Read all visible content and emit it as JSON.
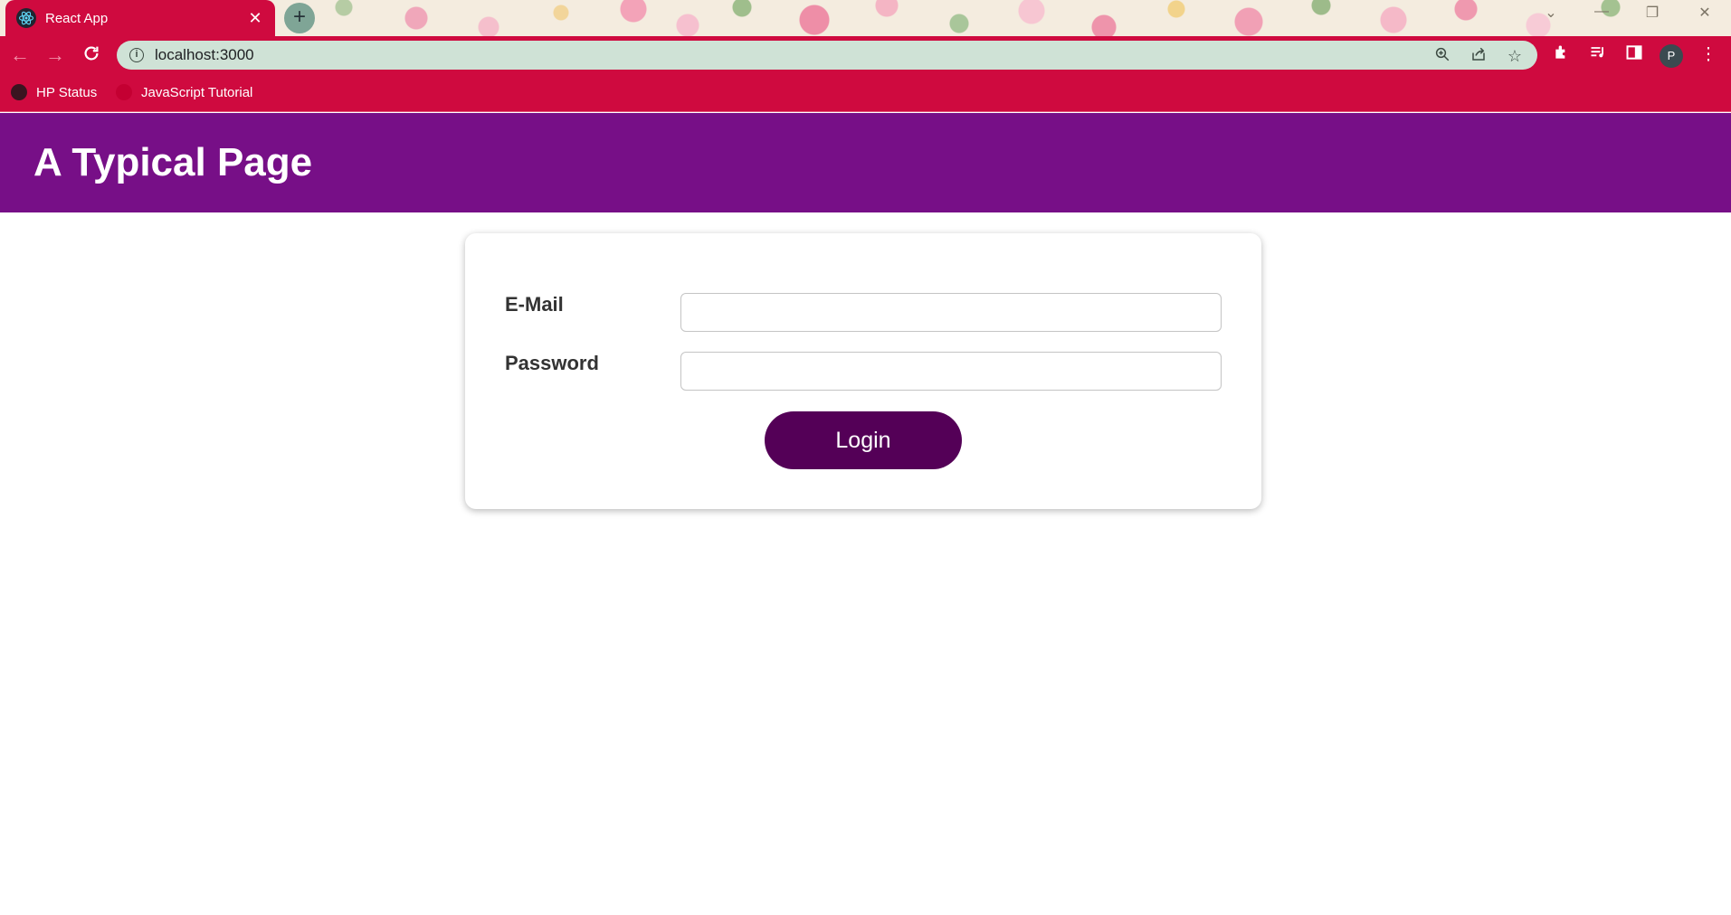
{
  "browser": {
    "tab_title": "React App",
    "tab_close": "✕",
    "new_tab": "+",
    "url": "localhost:3000",
    "profile_initial": "P",
    "icons": {
      "tab_favicon": "react-logo-icon",
      "back": "arrow-left-icon",
      "forward": "arrow-right-icon",
      "reload": "reload-icon",
      "site_info": "info-icon",
      "zoom": "zoom-icon",
      "share": "share-icon",
      "bookmark_star": "star-icon",
      "extensions": "puzzle-icon",
      "media": "media-queue-icon",
      "side_panel": "side-panel-icon",
      "menu": "kebab-menu-icon"
    }
  },
  "bookmarks_bar": {
    "items": [
      {
        "label": "HP Status"
      },
      {
        "label": "JavaScript Tutorial"
      }
    ]
  },
  "header": {
    "title": "A Typical Page"
  },
  "login_form": {
    "email_label": "E-Mail",
    "email_value": "",
    "password_label": "Password",
    "password_value": "",
    "submit_label": "Login"
  },
  "colors": {
    "chrome_accent": "#cf0a3f",
    "omnibox": "#cfe2d6",
    "header_bg": "#770f87",
    "button_bg": "#540057"
  }
}
